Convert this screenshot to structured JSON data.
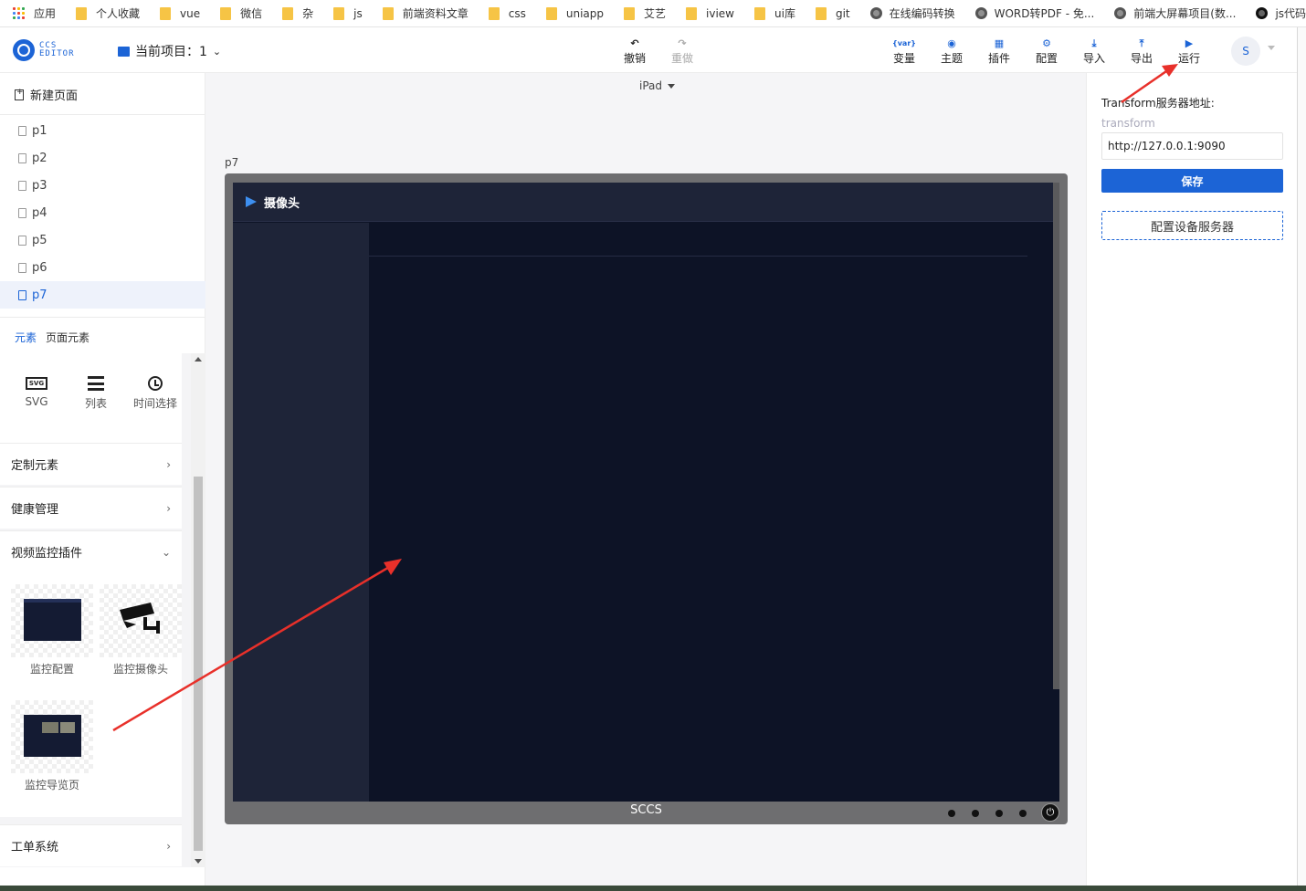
{
  "bookmarks": {
    "apps_label": "应用",
    "items": [
      {
        "label": "个人收藏",
        "kind": "folder"
      },
      {
        "label": "vue",
        "kind": "folder"
      },
      {
        "label": "微信",
        "kind": "folder"
      },
      {
        "label": "杂",
        "kind": "folder"
      },
      {
        "label": "js",
        "kind": "folder"
      },
      {
        "label": "前端资料文章",
        "kind": "folder"
      },
      {
        "label": "css",
        "kind": "folder"
      },
      {
        "label": "uniapp",
        "kind": "folder"
      },
      {
        "label": "艾艺",
        "kind": "folder"
      },
      {
        "label": "iview",
        "kind": "folder"
      },
      {
        "label": "ui库",
        "kind": "folder"
      },
      {
        "label": "git",
        "kind": "folder"
      },
      {
        "label": "在线编码转换",
        "kind": "globe"
      },
      {
        "label": "WORD转PDF - 免...",
        "kind": "globe"
      },
      {
        "label": "前端大屏幕项目(数...",
        "kind": "globe"
      },
      {
        "label": "js代码规范",
        "kind": "github"
      }
    ]
  },
  "toolbar": {
    "logo_line1": "CCS",
    "logo_line2": "EDITOR",
    "project_label": "当前项目：1",
    "undo": "撤销",
    "redo": "重做",
    "variables": "变量",
    "theme": "主题",
    "plugins": "插件",
    "config": "配置",
    "import": "导入",
    "export": "导出",
    "run": "运行",
    "avatar": "S",
    "var_icon_text": "{var}"
  },
  "sidebar": {
    "new_page": "新建页面",
    "pages": [
      "p1",
      "p2",
      "p3",
      "p4",
      "p5",
      "p6",
      "p7"
    ],
    "active_page": "p7",
    "tab_elements": "元素",
    "tab_page_elements": "页面元素",
    "basic_elements": [
      {
        "label": "SVG",
        "icon": "svg-icon",
        "icon_text": "SVG"
      },
      {
        "label": "列表",
        "icon": "list-icon"
      },
      {
        "label": "时间选择",
        "icon": "clock-icon"
      }
    ],
    "groups": {
      "custom": "定制元素",
      "health": "健康管理",
      "video": "视频监控插件",
      "workorder": "工单系统"
    },
    "video_plugins": [
      {
        "label": "监控配置"
      },
      {
        "label": "监控摄像头"
      },
      {
        "label": "监控导览页"
      }
    ]
  },
  "canvas": {
    "device": "iPad",
    "page_label": "p7",
    "screen_title": "摄像头",
    "bezel_text": "SCCS"
  },
  "right_panel": {
    "label": "Transform服务器地址:",
    "placeholder_hint": "transform",
    "url_value": "http://127.0.0.1:9090",
    "save": "保存",
    "config_server": "配置设备服务器"
  },
  "colors": {
    "accent": "#1c64d6",
    "screen_bg": "#0d1326",
    "annotation_arrow": "#e8302a"
  }
}
